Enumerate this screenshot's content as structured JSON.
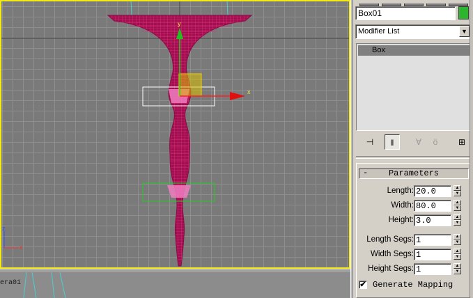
{
  "viewport": {
    "gizmo_x_label": "x",
    "gizmo_y_label": "y",
    "axis_z_label": "z",
    "axis_x_label": "x",
    "camera_label": "era01"
  },
  "panel": {
    "object_name": "Box01",
    "object_color": "#2db52d",
    "modifier_list": {
      "selected": "Modifier List"
    },
    "modifier_stack": [
      {
        "label": "Box"
      }
    ],
    "toolbar": [
      {
        "name": "pin-stack-icon",
        "glyph": "⊣",
        "state": "normal"
      },
      {
        "name": "show-end-result-icon",
        "glyph": "‖",
        "state": "pressed"
      },
      {
        "name": "make-unique-icon",
        "glyph": "∀",
        "state": "disabled"
      },
      {
        "name": "remove-modifier-icon",
        "glyph": "ö",
        "state": "disabled"
      },
      {
        "name": "configure-modifier-sets-icon",
        "glyph": "⊞",
        "state": "normal"
      }
    ],
    "parameters": {
      "collapse_symbol": "-",
      "title": "Parameters",
      "rows": [
        {
          "label": "Length:",
          "value": "20.0"
        },
        {
          "label": "Width:",
          "value": "80.0"
        },
        {
          "label": "Height:",
          "value": "3.0"
        },
        {
          "label": "Length Segs:",
          "value": "1"
        },
        {
          "label": "Width Segs:",
          "value": "1"
        },
        {
          "label": "Height Segs:",
          "value": "1"
        }
      ],
      "generate_mapping": {
        "label": "Generate Mapping",
        "checked": true,
        "mark": "✔"
      }
    }
  },
  "colors": {
    "grid_bg": "#7a7a7a",
    "mesh": "#b0125a",
    "viewport_border": "#f2ea1a",
    "panel_bg": "#d4d0c8"
  }
}
